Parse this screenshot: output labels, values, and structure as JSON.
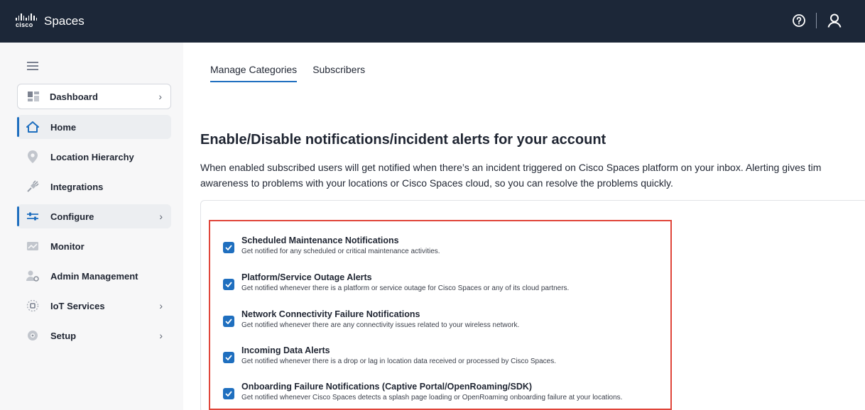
{
  "header": {
    "brand": "cisco",
    "app_title": "Spaces"
  },
  "sidebar": {
    "dashboard_label": "Dashboard",
    "items": [
      {
        "label": "Home"
      },
      {
        "label": "Location Hierarchy"
      },
      {
        "label": "Integrations"
      },
      {
        "label": "Configure"
      },
      {
        "label": "Monitor"
      },
      {
        "label": "Admin Management"
      },
      {
        "label": "IoT Services"
      },
      {
        "label": "Setup"
      }
    ]
  },
  "tabs": [
    {
      "label": "Manage Categories"
    },
    {
      "label": "Subscribers"
    }
  ],
  "main": {
    "heading": "Enable/Disable notifications/incident alerts for your account",
    "description_line1": "When enabled subscribed users will get notified when there’s an incident triggered on Cisco Spaces platform on your inbox. Alerting gives tim",
    "description_line2": "awareness to problems with your locations or Cisco Spaces cloud, so you can resolve the problems quickly."
  },
  "notifications": [
    {
      "title": "Scheduled Maintenance Notifications",
      "desc": "Get notified for any scheduled or critical maintenance activities.",
      "checked": true
    },
    {
      "title": "Platform/Service Outage Alerts",
      "desc": "Get notified whenever there is a platform or service outage for Cisco Spaces or any of its cloud partners.",
      "checked": true
    },
    {
      "title": "Network Connectivity Failure Notifications",
      "desc": "Get notified whenever there are any connectivity issues related to your wireless network.",
      "checked": true
    },
    {
      "title": "Incoming Data Alerts",
      "desc": "Get notified whenever there is a drop or lag in location data received or processed by Cisco Spaces.",
      "checked": true
    },
    {
      "title": "Onboarding Failure Notifications (Captive Portal/OpenRoaming/SDK)",
      "desc": "Get notified whenever Cisco Spaces detects a splash page loading or OpenRoaming onboarding failure at your locations.",
      "checked": true
    }
  ],
  "colors": {
    "header_bg": "#1c2738",
    "accent": "#1f6fbf",
    "highlight_border": "#e0453a"
  }
}
